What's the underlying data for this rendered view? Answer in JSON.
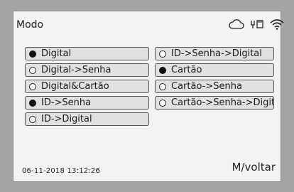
{
  "header": {
    "title": "Modo",
    "icons": [
      "cloud-icon",
      "ethernet-icon",
      "wifi-icon"
    ]
  },
  "options_left": [
    {
      "label": "Digital",
      "selected": true
    },
    {
      "label": "Digital->Senha",
      "selected": false
    },
    {
      "label": "Digital&Cartão",
      "selected": false
    },
    {
      "label": "ID->Senha",
      "selected": true
    },
    {
      "label": "ID->Digital",
      "selected": false
    }
  ],
  "options_right": [
    {
      "label": "ID->Senha->Digital",
      "selected": false
    },
    {
      "label": "Cartão",
      "selected": true
    },
    {
      "label": "Cartão->Senha",
      "selected": false
    },
    {
      "label": "Cartão->Senha->Digit",
      "selected": false
    }
  ],
  "footer": {
    "datetime": "06-11-2018  13:12:26",
    "back_label": "M/voltar"
  }
}
